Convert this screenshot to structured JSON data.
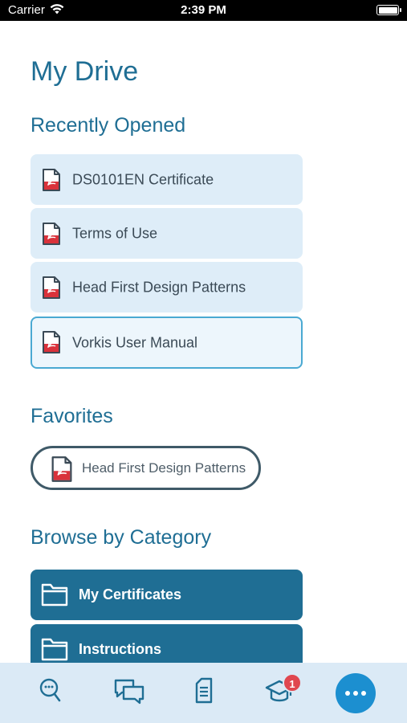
{
  "status_bar": {
    "carrier": "Carrier",
    "time": "2:39 PM"
  },
  "page": {
    "title": "My Drive"
  },
  "recently_opened": {
    "title": "Recently Opened",
    "items": [
      {
        "label": "DS0101EN Certificate",
        "icon": "pdf-icon"
      },
      {
        "label": "Terms of Use",
        "icon": "pdf-icon"
      },
      {
        "label": "Head First Design Patterns",
        "icon": "pdf-icon"
      },
      {
        "label": "Vorkis User Manual",
        "icon": "pdf-icon",
        "selected": true
      }
    ]
  },
  "favorites": {
    "title": "Favorites",
    "items": [
      {
        "label": "Head First Design Patterns",
        "icon": "pdf-icon"
      }
    ]
  },
  "browse": {
    "title": "Browse by Category",
    "items": [
      {
        "label": "My Certificates",
        "icon": "folder-icon"
      },
      {
        "label": "Instructions",
        "icon": "folder-icon"
      }
    ]
  },
  "tab_bar": {
    "tabs": [
      {
        "icon": "chat-search-icon"
      },
      {
        "icon": "messages-icon"
      },
      {
        "icon": "document-list-icon"
      },
      {
        "icon": "graduation-cap-icon",
        "badge": "1"
      }
    ],
    "more_icon": "ellipsis-icon"
  },
  "colors": {
    "primary": "#1f6e94",
    "card_bg": "#deedf8",
    "selected_border": "#4aa9d2",
    "tab_bar_bg": "#dbeaf6",
    "badge": "#e0474f",
    "more_button": "#1c8fd0"
  }
}
